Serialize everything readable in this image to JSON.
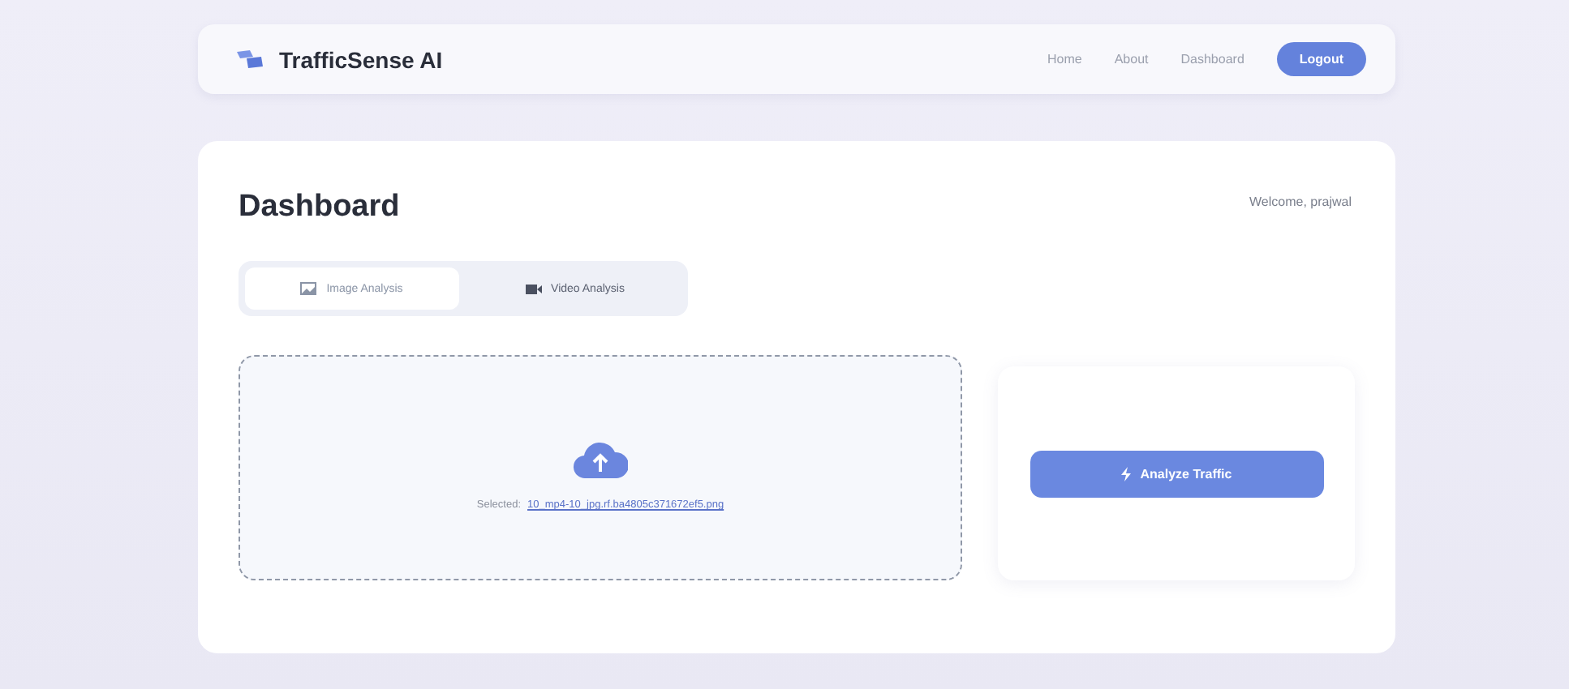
{
  "navbar": {
    "brand": "TrafficSense AI",
    "links": [
      {
        "label": "Home"
      },
      {
        "label": "About"
      },
      {
        "label": "Dashboard"
      }
    ],
    "logout": "Logout"
  },
  "page": {
    "title": "Dashboard",
    "welcome": "Welcome, prajwal"
  },
  "tabs": [
    {
      "label": "Image Analysis",
      "kind": "image",
      "selected": true
    },
    {
      "label": "Video Analysis",
      "kind": "video",
      "selected": false
    }
  ],
  "upload": {
    "prefix": "Selected:",
    "filename": "10_mp4-10_jpg.rf.ba4805c371672ef5.png"
  },
  "analyze_button": "Analyze Traffic"
}
